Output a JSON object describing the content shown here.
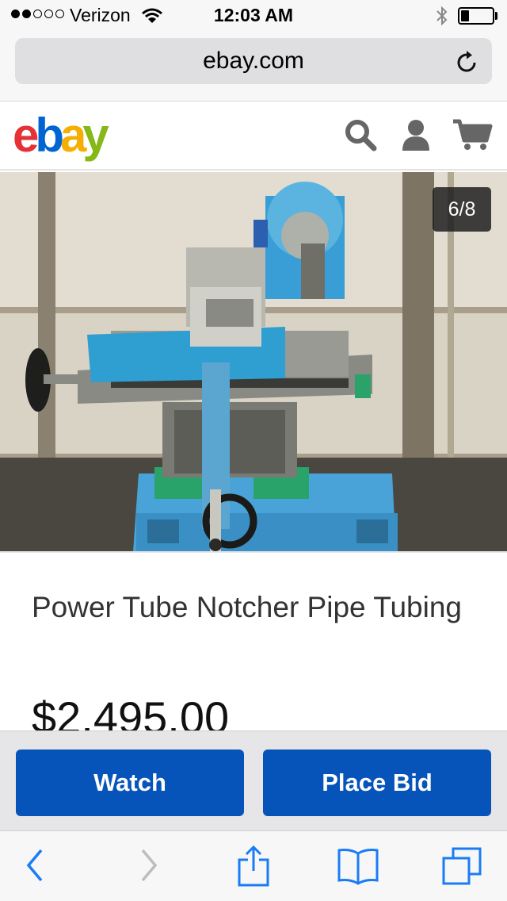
{
  "status_bar": {
    "carrier": "Verizon",
    "signal_strength": 2,
    "signal_max": 5,
    "time": "12:03 AM",
    "battery_level": 0.25
  },
  "browser": {
    "url": "ebay.com"
  },
  "header": {
    "logo": {
      "e": "e",
      "b": "b",
      "a": "a",
      "y": "y"
    },
    "icons": [
      "search-icon",
      "user-icon",
      "cart-icon"
    ]
  },
  "gallery": {
    "counter": "6/8"
  },
  "listing": {
    "title": "Power Tube Notcher Pipe Tubing",
    "price": "$2,495.00"
  },
  "actions": {
    "watch_label": "Watch",
    "bid_label": "Place Bid"
  },
  "toolbar": {
    "icons": [
      "back-icon",
      "forward-icon",
      "share-icon",
      "bookmarks-icon",
      "tabs-icon"
    ]
  },
  "colors": {
    "ebay_red": "#e53238",
    "ebay_blue": "#0064d2",
    "ebay_yellow": "#f5af02",
    "ebay_green": "#86b817",
    "button_blue": "#0654ba",
    "ios_blue": "#1a7cf5"
  }
}
